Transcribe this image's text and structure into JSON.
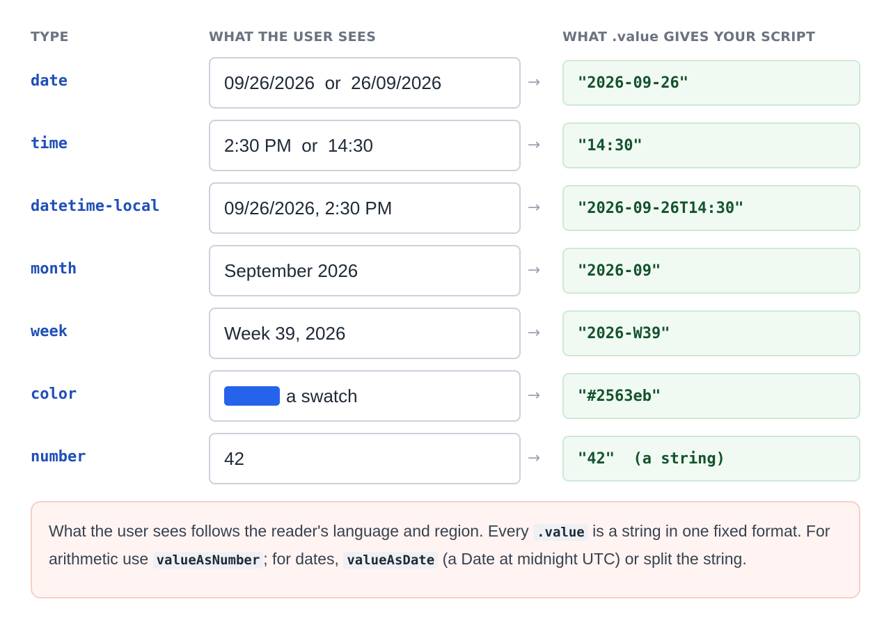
{
  "headers": {
    "type": "TYPE",
    "sees": "WHAT THE USER SEES",
    "value": "WHAT .value GIVES YOUR SCRIPT"
  },
  "arrow": "→",
  "rows": [
    {
      "type": "date",
      "sees": "09/26/2026  or  26/09/2026",
      "value": "\"2026-09-26\""
    },
    {
      "type": "time",
      "sees": "2:30 PM  or  14:30",
      "value": "\"14:30\""
    },
    {
      "type": "datetime-local",
      "sees": "09/26/2026, 2:30 PM",
      "value": "\"2026-09-26T14:30\""
    },
    {
      "type": "month",
      "sees": "September 2026",
      "value": "\"2026-09\""
    },
    {
      "type": "week",
      "sees": "Week 39, 2026",
      "value": "\"2026-W39\""
    },
    {
      "type": "color",
      "sees": "a swatch",
      "swatch_color": "#2563eb",
      "value": "\"#2563eb\""
    },
    {
      "type": "number",
      "sees": "42",
      "value": "\"42\"  (a string)"
    }
  ],
  "note": {
    "part1": "What the user sees follows the reader's language and region. Every ",
    "code1": ".value",
    "part2": " is a string in one fixed format. For arithmetic use ",
    "code2": "valueAsNumber",
    "part3": "; for dates, ",
    "code3": "valueAsDate",
    "part4": " (a Date at midnight UTC) or split the string."
  }
}
